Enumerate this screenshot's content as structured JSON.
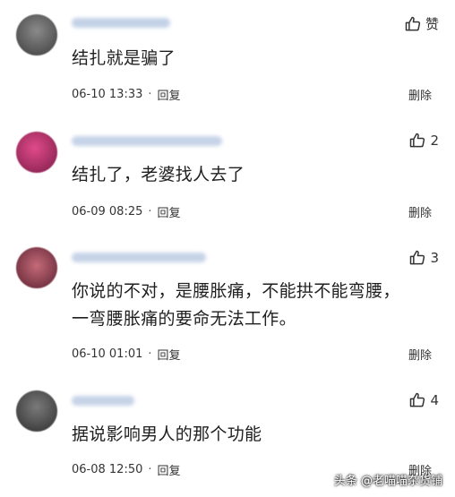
{
  "comments": [
    {
      "like_label": "赞",
      "text": "结扎就是骗了",
      "time": "06-10 13:33",
      "reply": "回复",
      "delete": "删除",
      "colors": {
        "avatar": "#5a5a5a",
        "username": "#b8c8e0"
      }
    },
    {
      "like_label": "2",
      "text": "结扎了，老婆找人去了",
      "time": "06-09 08:25",
      "reply": "回复",
      "delete": "删除",
      "colors": {
        "avatar": "#b0306a",
        "username": "#b8c8e0"
      }
    },
    {
      "like_label": "3",
      "text_line1": "你说的不对，是腰胀痛，不能拱不能弯腰，",
      "text_line2": "一弯腰胀痛的要命无法工作。",
      "time": "06-10 01:01",
      "reply": "回复",
      "delete": "删除",
      "colors": {
        "avatar": "#a04a5a",
        "username": "#b8c8e0"
      }
    },
    {
      "like_label": "4",
      "text": "据说影响男人的那个功能",
      "time": "06-08 12:50",
      "reply": "回复",
      "delete": "删除",
      "colors": {
        "avatar": "#4a4a4a",
        "username": "#b8c8e0"
      }
    }
  ],
  "watermark": "头条 @老喵喵杂货铺",
  "icons": {
    "like": "thumbs-up-icon"
  }
}
